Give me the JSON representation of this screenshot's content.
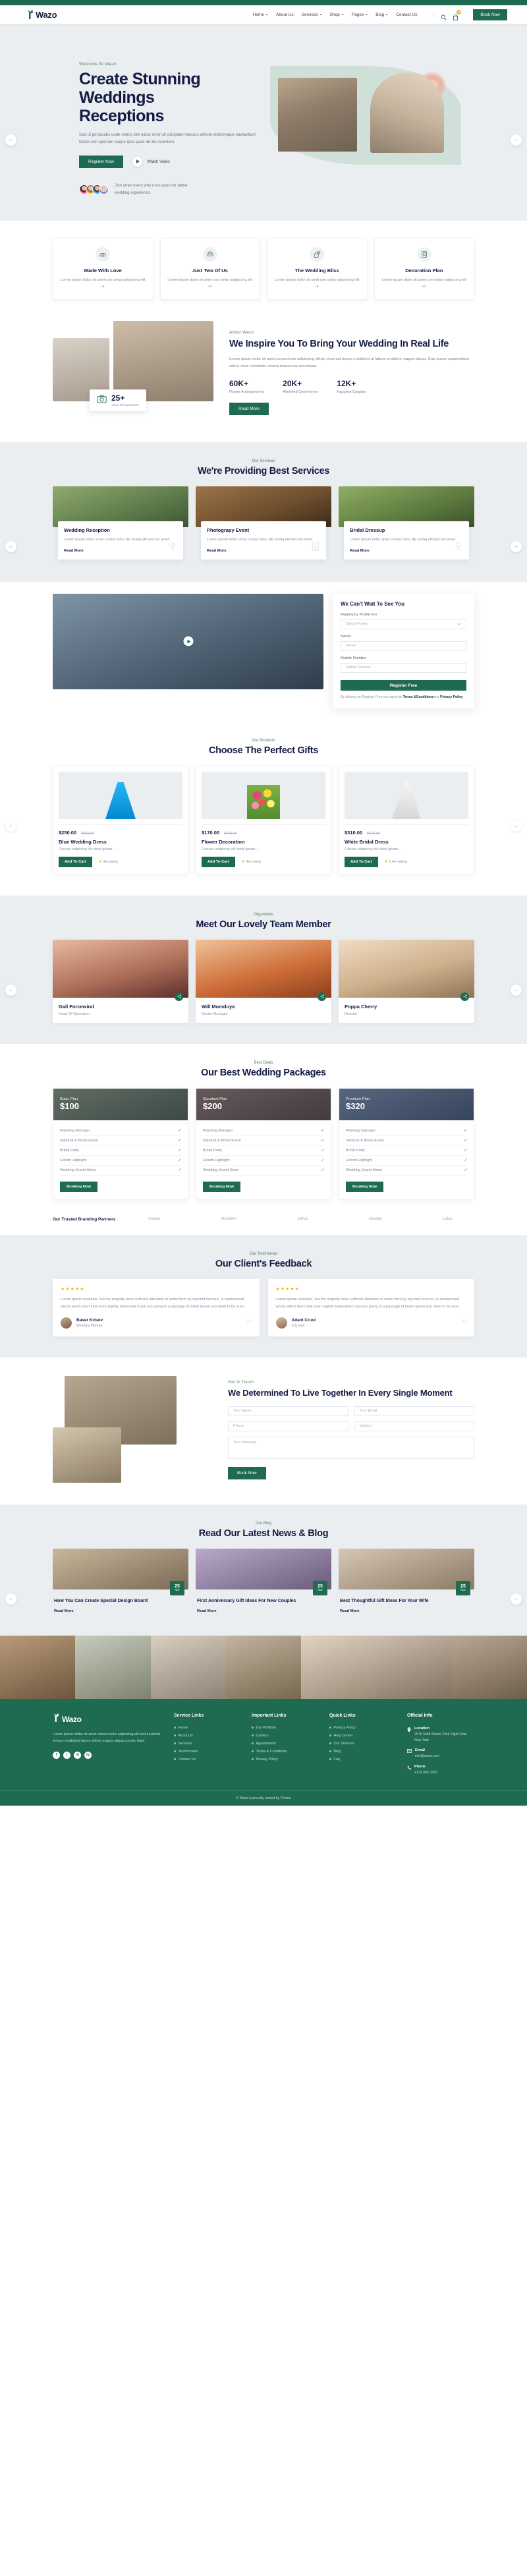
{
  "brand": {
    "name": "Wazo"
  },
  "header": {
    "nav": [
      {
        "label": "Home",
        "caret": true
      },
      {
        "label": "About Us",
        "caret": false
      },
      {
        "label": "Services",
        "caret": true
      },
      {
        "label": "Shop",
        "caret": true
      },
      {
        "label": "Pages",
        "caret": true
      },
      {
        "label": "Blog",
        "caret": true
      },
      {
        "label": "Contact Us",
        "caret": false
      }
    ],
    "search_icon": "search-icon",
    "cart_icon": "cart-icon",
    "cart_count": "10",
    "book_label": "Book Now"
  },
  "hero": {
    "eyebrow": "Welcome To Wazo",
    "title_l1": "Create Stunning",
    "title_l2": "Weddings",
    "title_l3": "Receptions",
    "description": "Sed ut persiciatis unde omnis iste natus error sit voluptate maccus antium doloremque laudantium totam rem aperiam eaque ipsa quae ab illo inventore.",
    "primary_btn": "Register Now",
    "watch_label": "Watch Video",
    "users_text": "Join other users who uses wazo for better wedding experience.",
    "arrow_left": "←",
    "arrow_right": "→"
  },
  "features": [
    {
      "title": "Made With Love",
      "desc": "Lorem ipsum dolor sit amet con ctetur adipiscing elit ut",
      "icon": "rings-icon"
    },
    {
      "title": "Just Two Of Us",
      "desc": "Lorem ipsum dolor sit amet con ctetur adipiscing elit ut",
      "icon": "cake-icon"
    },
    {
      "title": "The Wedding Bliss",
      "desc": "Lorem ipsum dolor sit amet con ctetur adipiscing elit ut",
      "icon": "love-lock-icon"
    },
    {
      "title": "Decoration Plan",
      "desc": "Lorem ipsum dolor sit amet con ctetur adipiscing elit ut",
      "icon": "clipboard-icon"
    }
  ],
  "about": {
    "eyebrow": "About Wazo",
    "title": "We Inspire You To Bring Your Wedding In Real Life",
    "description": "Lorem ipsum dolor sit amet,consectetur adipiscing elit,do eiusmod tempo incididunt ut labore et dolore magna aliqua. Quis ipsum suspendisse ultrice risus commodo viverra maecenas accumsan.",
    "stats": [
      {
        "value": "60K+",
        "label": "Flower Arrangements"
      },
      {
        "value": "20K+",
        "label": "Attended Ceremonies"
      },
      {
        "value": "12K+",
        "label": "Happiest Couples"
      }
    ],
    "button": "Read More",
    "badge_value": "25+",
    "badge_label": "Years Of Experience",
    "badge_icon": "camera-icon"
  },
  "services": {
    "eyebrow": "Our Services",
    "title": "We're Providing Best Services",
    "items": [
      {
        "title": "Wedding Reception",
        "desc": "Lorem ipsum dolor amet consec tetur dip iscing elit sed est amet.",
        "link": "Read More",
        "icon": "bouquet-icon"
      },
      {
        "title": "Photograpy Event",
        "desc": "Lorem ipsum dolor amet consec tetur dip iscing elit sed est amet.",
        "link": "Read More",
        "icon": "invitation-icon"
      },
      {
        "title": "Bridal Dressup",
        "desc": "Lorem ipsum dolor amet consec tetur dip iscing elit sed est amet.",
        "link": "Read More",
        "icon": "bride-icon"
      }
    ]
  },
  "booking": {
    "title": "We Can't Wait To See You",
    "fields": [
      {
        "label": "Matrimony Profile For",
        "placeholder": "Select Profile",
        "type": "select"
      },
      {
        "label": "Name",
        "placeholder": "Name",
        "type": "text"
      },
      {
        "label": "Mobile Number",
        "placeholder": "Mobile Number",
        "type": "text"
      }
    ],
    "submit": "Register Free",
    "terms_a": "By clicking on Register Free,you agree to ",
    "terms_b": "Terms &Conditions",
    "terms_c": "and ",
    "terms_d": "Privacy Policy",
    "play_icon": "play-icon"
  },
  "products": {
    "eyebrow": "Our Products",
    "title": "Choose The Perfect Gifts",
    "items": [
      {
        "price": "$250.00",
        "old_price": "$550.00",
        "title": "Blue Wedding Dress",
        "desc": "Consec adipicing elit debit ipsam ...",
        "button": "Add To Cart",
        "rating": "3k+rating"
      },
      {
        "price": "$170.00",
        "old_price": "$210.00",
        "title": "Flower Decoration",
        "desc": "Consec adipicing elit debit ipsam ...",
        "button": "Add To Cart",
        "rating": "4k+rating"
      },
      {
        "price": "$310.00",
        "old_price": "$550.00",
        "title": "White Bridal Dress",
        "desc": "Consec adipicing elit debit ipsam ...",
        "button": "Add To Cart",
        "rating": "1.4k+rating"
      }
    ]
  },
  "team": {
    "eyebrow": "Organizers",
    "title": "Meet Our Lovely Team Member",
    "members": [
      {
        "name": "Gail Forcewind",
        "role": "Head Of Operation",
        "share_icon": "share-icon"
      },
      {
        "name": "Will Mumduya",
        "role": "Senior Manager",
        "share_icon": "share-icon"
      },
      {
        "name": "Poppa Cherry",
        "role": "Director",
        "share_icon": "share-icon"
      }
    ]
  },
  "packages": {
    "eyebrow": "Best Deals",
    "title": "Our Best Wedding Packages",
    "items": [
      {
        "name": "Basic Plan",
        "price": "$100",
        "features": [
          "Planning Manager",
          "National & Bridal Event",
          "Bridal Party",
          "Groom Highlight",
          "Wedding Grand Show"
        ],
        "button": "Booking Now"
      },
      {
        "name": "Standard Plan",
        "price": "$200",
        "features": [
          "Planning Manager",
          "National & Bridal Event",
          "Bridal Party",
          "Groom Highlight",
          "Wedding Grand Show"
        ],
        "button": "Booking Now"
      },
      {
        "name": "Premium Plan",
        "price": "$320",
        "features": [
          "Planning Manager",
          "National & Bridal Event",
          "Bridal Party",
          "Groom Highlight",
          "Wedding Grand Show"
        ],
        "button": "Booking Now"
      }
    ]
  },
  "partners": {
    "label": "Our Trusted Branding Partners",
    "logos": [
      "Amaze",
      "Mundem",
      "Citrus",
      "Novatis",
      "Lotus"
    ]
  },
  "testimonials": {
    "eyebrow": "Our Testimonial",
    "title": "Our Client's Feedback",
    "items": [
      {
        "stars": "★★★★★",
        "quote": "Lorem ipsum available, but the majority have suffered alteration in some form by injected humour, or randomised words which don't look even slightly believable if you are going to a passage of lorem ipsum you need to be sure.",
        "name": "Baser Krisov",
        "role": "Wedding Planner"
      },
      {
        "stars": "★★★★★",
        "quote": "Lorem ipsum available, but the majority have suffered alteration in some form by injected humour, or randomised words which don't look even slightly believable if you are going to a passage of lorem ipsum you need to be sure.",
        "name": "Adam Crust",
        "role": "City Hall"
      }
    ]
  },
  "contact": {
    "eyebrow": "Get In Touch",
    "title": "We Determined To Live Together In Every Single Moment",
    "fields": [
      {
        "placeholder": "Your Name"
      },
      {
        "placeholder": "Your Email"
      },
      {
        "placeholder": "Phone"
      },
      {
        "placeholder": "Subject"
      }
    ],
    "message_placeholder": "Your Message",
    "button": "Book Now"
  },
  "blog": {
    "eyebrow": "Our Blog",
    "title": "Read Our Latest News & Blog",
    "posts": [
      {
        "day": "25",
        "month": "Nov",
        "title": "How You Can Create Special Design Board",
        "link": "Read More"
      },
      {
        "day": "25",
        "month": "Nov",
        "title": "First Anniversary Gift Ideas For New Couples",
        "link": "Read More"
      },
      {
        "day": "25",
        "month": "Nov",
        "title": "Best Thoughtful Gift Ideas For Your Wife",
        "link": "Read More"
      }
    ]
  },
  "footer": {
    "brand": "Wazo",
    "description": "Lorem ipsum dollar sit amet consec tetur adipiscing elit sed eiusmod tempor incididunt labore dolore magna aliqua consec tetur.",
    "social": [
      "f",
      "t",
      "in",
      "ig"
    ],
    "columns": [
      {
        "heading": "Service Links",
        "items": [
          "Home",
          "About Us",
          "Services",
          "Testimonials",
          "Contact Us"
        ]
      },
      {
        "heading": "Important Links",
        "items": [
          "Our Portfolio",
          "Careers",
          "Appointment",
          "Terms & Conditions",
          "Privacy Policy"
        ]
      },
      {
        "heading": "Quick Links",
        "items": [
          "Privacy Policy",
          "Help Center",
          "Our Services",
          "Blog",
          "Faq"
        ]
      }
    ],
    "info_heading": "Official Info",
    "info": [
      {
        "icon": "location-icon",
        "title": "Location",
        "detail": "2578 Sixth Street, Park Right Side, New York"
      },
      {
        "icon": "mail-icon",
        "title": "Email",
        "detail": "info@wazo.com"
      },
      {
        "icon": "phone-icon",
        "title": "Phone",
        "detail": "+123 456 7890"
      }
    ],
    "copyright": "© Wazo is proudly owned by Theme"
  }
}
